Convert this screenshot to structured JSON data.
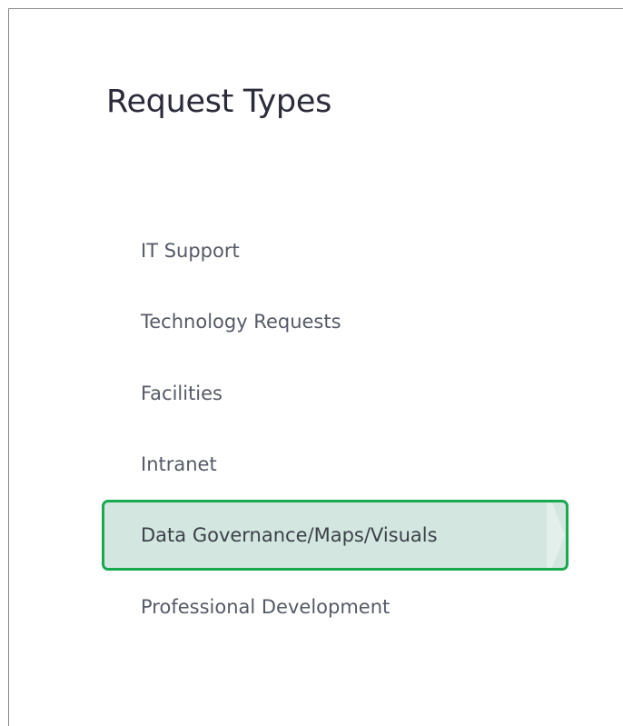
{
  "panel": {
    "title": "Request Types"
  },
  "menu": {
    "items": [
      {
        "label": "IT Support",
        "active": false
      },
      {
        "label": "Technology Requests",
        "active": false
      },
      {
        "label": "Facilities",
        "active": false
      },
      {
        "label": "Intranet",
        "active": false
      },
      {
        "label": "Data Governance/Maps/Visuals",
        "active": true
      },
      {
        "label": "Professional Development",
        "active": false
      }
    ]
  },
  "colors": {
    "active_background": "#d3e7e0",
    "active_border": "#1aa851",
    "text": "#555a66",
    "title": "#2b2b3a"
  }
}
